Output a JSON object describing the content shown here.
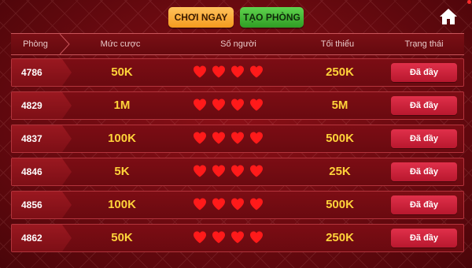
{
  "top": {
    "play_now_label": "CHƠI NGAY",
    "create_room_label": "TẠO PHÒNG"
  },
  "header": {
    "room": "Phòng",
    "bet": "Mức cược",
    "players": "Số người",
    "minimum": "Tối thiểu",
    "status": "Trạng thái"
  },
  "rows": [
    {
      "room": "4786",
      "bet": "50K",
      "players": 4,
      "minimum": "250K",
      "status": "Đã đầy"
    },
    {
      "room": "4829",
      "bet": "1M",
      "players": 4,
      "minimum": "5M",
      "status": "Đã đầy"
    },
    {
      "room": "4837",
      "bet": "100K",
      "players": 4,
      "minimum": "500K",
      "status": "Đã đầy"
    },
    {
      "room": "4846",
      "bet": "5K",
      "players": 4,
      "minimum": "25K",
      "status": "Đã đầy"
    },
    {
      "room": "4856",
      "bet": "100K",
      "players": 4,
      "minimum": "500K",
      "status": "Đã đầy"
    },
    {
      "room": "4862",
      "bet": "50K",
      "players": 4,
      "minimum": "250K",
      "status": "Đã đầy"
    }
  ],
  "icons": {
    "home": "home-icon",
    "player": "heart-icon"
  },
  "colors": {
    "heart": "#ff1a1a",
    "value": "#ffd33a",
    "status": "#d0223c"
  }
}
